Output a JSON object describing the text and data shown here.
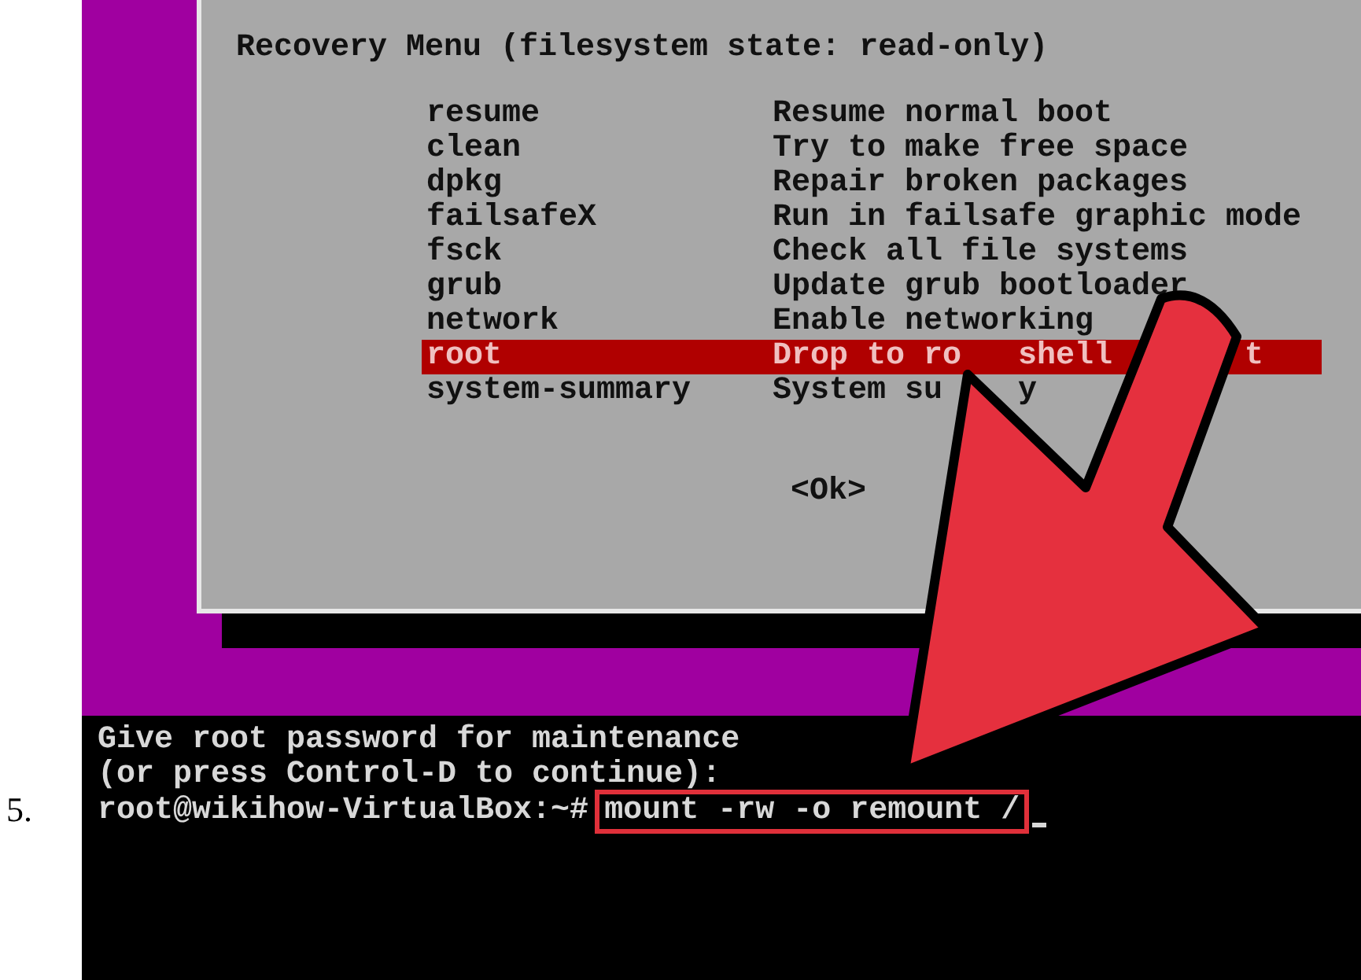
{
  "step_number": "5.",
  "recovery_menu": {
    "title": "Recovery Menu (filesystem state: read-only)",
    "items": [
      {
        "name": "resume",
        "description": [
          "Resume normal boot"
        ],
        "selected": false
      },
      {
        "name": "clean",
        "description": [
          "Try to make free space"
        ],
        "selected": false
      },
      {
        "name": "dpkg",
        "description": [
          "Repair broken packages"
        ],
        "selected": false
      },
      {
        "name": "failsafeX",
        "description": [
          "Run in failsafe graphic mode"
        ],
        "selected": false
      },
      {
        "name": "fsck",
        "description": [
          "Check all file systems"
        ],
        "selected": false
      },
      {
        "name": "grub",
        "description": [
          "Update grub bootloader"
        ],
        "selected": false
      },
      {
        "name": "network",
        "description": [
          "Enable networking"
        ],
        "selected": false
      },
      {
        "name": "root",
        "description": [
          "Drop to ro",
          "shell",
          "t"
        ],
        "selected": true
      },
      {
        "name": "system-summary",
        "description": [
          "System su",
          "y"
        ],
        "selected": false
      }
    ],
    "ok_button": "<Ok>"
  },
  "terminal": {
    "lines": [
      "Give root password for maintenance",
      "(or press Control-D to continue):"
    ],
    "prompt": "root@wikihow-VirtualBox:~#",
    "command": "mount -rw -o remount /"
  }
}
